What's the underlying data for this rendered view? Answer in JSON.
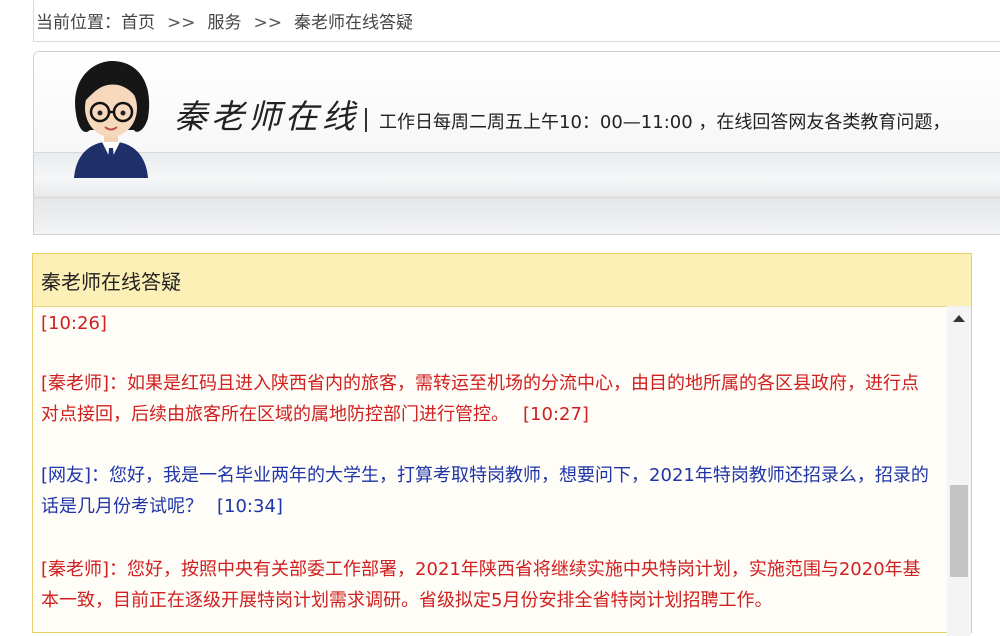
{
  "breadcrumb": {
    "label": "当前位置：",
    "items": [
      "首页",
      "服务",
      "秦老师在线答疑"
    ],
    "separator": ">>"
  },
  "banner": {
    "title": "秦老师在线",
    "description": "工作日每周二周五上午10：00—11:00 ，在线回答网友各类教育问题，"
  },
  "panel": {
    "title": "秦老师在线答疑",
    "messages": [
      {
        "role": "timestamp",
        "text": "[10:26]"
      },
      {
        "role": "teacher",
        "text": "[秦老师]：如果是红码且进入陕西省内的旅客，需转运至机场的分流中心，由目的地所属的各区县政府，进行点对点接回，后续由旅客所在区域的属地防控部门进行管控。",
        "time": "[10:27]"
      },
      {
        "role": "netizen",
        "text": "[网友]：您好，我是一名毕业两年的大学生，打算考取特岗教师，想要问下，2021年特岗教师还招录么，招录的话是几月份考试呢？",
        "time": "[10:34]"
      },
      {
        "role": "teacher",
        "text": "[秦老师]：您好，按照中央有关部委工作部署，2021年陕西省将继续实施中央特岗计划，实施范围与2020年基本一致，目前正在逐级开展特岗计划需求调研。省级拟定5月份安排全省特岗计划招聘工作。",
        "time": ""
      }
    ]
  },
  "colors": {
    "teacher": "#d02020",
    "netizen": "#1f35a8",
    "panel_header": "#fdf0b6"
  }
}
